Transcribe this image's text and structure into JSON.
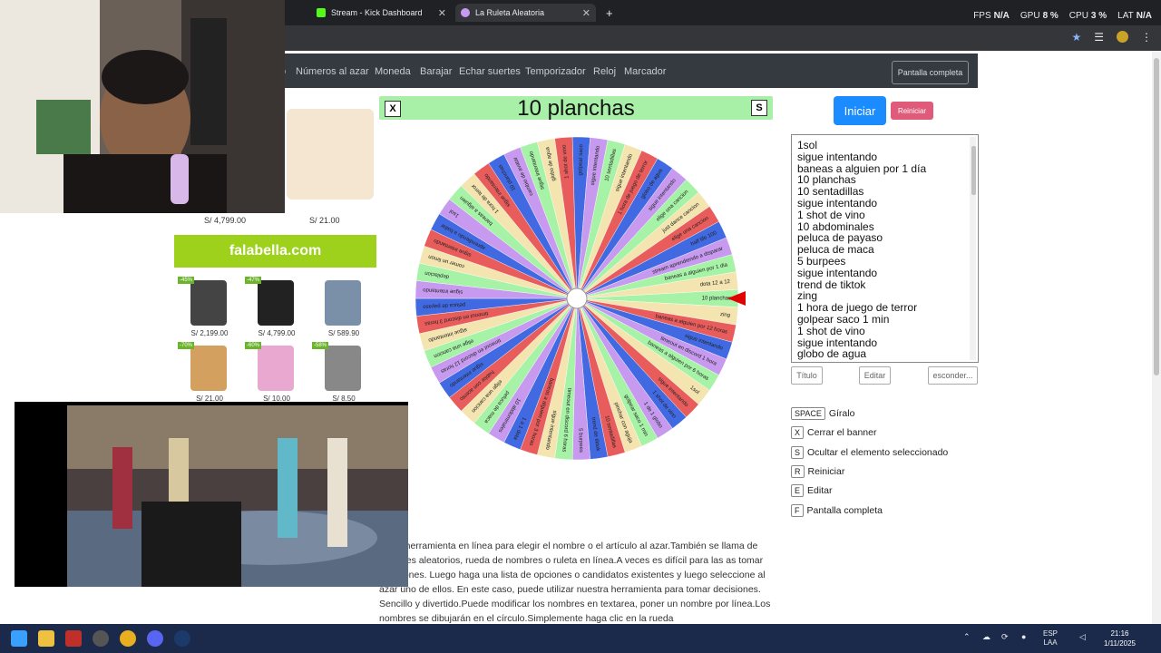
{
  "browser": {
    "tabs": [
      {
        "title": "Stream - Kick Dashboard",
        "favicon_color": "#53fc18"
      },
      {
        "title": "La Ruleta Aleatoria",
        "favicon_color": "#c79af0"
      }
    ],
    "new_tab": "+",
    "perf": {
      "fps_label": "FPS",
      "fps": "N/A",
      "gpu_label": "GPU",
      "gpu": "8 %",
      "cpu_label": "CPU",
      "cpu": "3 %",
      "lat_label": "LAT",
      "lat": "N/A"
    }
  },
  "nav": {
    "links": [
      "Números al azar",
      "Moneda",
      "Barajar",
      "Echar suertes",
      "Temporizador",
      "Reloj",
      "Marcador"
    ],
    "fullscreen": "Pantalla completa",
    "partial_first": "o"
  },
  "ads": {
    "prices_top": [
      "S/ 4,799.00",
      "S/ 21.00"
    ],
    "brand": "falabella.com",
    "products": [
      {
        "badge": "-45%",
        "price": "S/ 2,199.00",
        "color": "#444"
      },
      {
        "badge": "-47%",
        "price": "S/ 4,799.00",
        "color": "#222"
      },
      {
        "badge": "",
        "price": "S/ 589.90",
        "color": "#7a8fa8"
      },
      {
        "badge": "-70%",
        "price": "S/ 21.00",
        "color": "#d4a060"
      },
      {
        "badge": "-60%",
        "price": "S/ 10.00",
        "color": "#e8a8d0"
      },
      {
        "badge": "-58%",
        "price": "S/ 8.50",
        "color": "#888"
      }
    ]
  },
  "banner": {
    "close": "X",
    "hide": "S",
    "title": "10 planchas"
  },
  "controls": {
    "start": "Iniciar",
    "reset": "Reiniciar",
    "title_btn": "Título",
    "edit_btn": "Editar",
    "hide_btn": "esconder..."
  },
  "entries": [
    "1sol",
    "sigue intentando",
    "baneas a alguien por 1 día",
    "10 planchas",
    "10 sentadillas",
    "sigue intentando",
    "1 shot de vino",
    "10 abdominales",
    "peluca de payaso",
    "peluca de maca",
    "5 burpees",
    "sigue intentando",
    "trend de tiktok",
    "zing",
    "1 hora de juego de terror",
    "golpear saco 1 min",
    "1 shot de vino",
    "sigue intentando",
    "globo de agua"
  ],
  "wheel_labels": [
    "10 planchas",
    "zing",
    "baneas a alguien por 12 horas",
    "sigue intentando",
    "timeout en discord 1 hora",
    "baneas a alguien por 6 horas",
    "1sol",
    "sigue intentando",
    "1 shot de vino",
    "1 de 1 globo",
    "golpear saco 1 min",
    "pinchar con aguja",
    "10 sentadillas",
    "trend de tiktok",
    "5 burpees",
    "timeout en discord 6 horas",
    "sigue intentando",
    "baneas a alguien por 3 horas",
    "1 a 1 dota",
    "10 abdominales",
    "peluca de maca",
    "elige una cancion",
    "hablar con acento",
    "sigue intentando",
    "timeout en discord 12 horas",
    "elige una cancion",
    "sigue intentando",
    "timeout en discord 3 horas",
    "peluca de payaso",
    "sigue intentando",
    "depilacion",
    "comer un limon",
    "sigue intentando",
    "aprendiendo a bailar",
    "1sol",
    "baneas a alguien",
    "1 hora de terror",
    "sigue intentando",
    "10 planchas",
    "cambio de avatar",
    "sigue intentando",
    "globo de agua",
    "1 shot de vino",
    "golpear saco",
    "sigue intentando",
    "10 sentadillas",
    "sigue intentando",
    "1 hora de juego de terror",
    "globo de agua",
    "sigue intentando",
    "elige una cancion",
    "just dance cancion",
    "elige una cancion",
    "half life 100",
    "stream aprendiendo a disparar",
    "baneas a alguien por 1 dia",
    "dota 12 a 12"
  ],
  "wheel_colors": [
    "#a6f2a6",
    "#f3e4b0",
    "#e85c5c",
    "#4169e1",
    "#c79af0"
  ],
  "shortcuts": [
    {
      "key": "SPACE",
      "label": "Gíralo"
    },
    {
      "key": "X",
      "label": "Cerrar el banner"
    },
    {
      "key": "S",
      "label": "Ocultar el elemento seleccionado"
    },
    {
      "key": "R",
      "label": "Reiniciar"
    },
    {
      "key": "E",
      "label": "Editar"
    },
    {
      "key": "F",
      "label": "Pantalla completa"
    }
  ],
  "description": "s una herramienta en línea para elegir el nombre o el artículo al azar.También se llama de nombres aleatorios, rueda de nombres o ruleta en línea.A veces es difícil para las as tomar decisiones. Luego haga una lista de opciones o candidatos existentes y luego seleccione al azar uno de ellos. En este caso, puede utilizar nuestra herramienta para tomar decisiones. Sencillo y divertido.Puede modificar los nombres en textarea, poner un nombre por línea.Los nombres se dibujarán en el círculo.Simplemente haga clic en la rueda",
  "taskbar": {
    "lang_top": "ESP",
    "lang_bottom": "LAA",
    "time": "21:16",
    "date": "1/11/2025"
  }
}
